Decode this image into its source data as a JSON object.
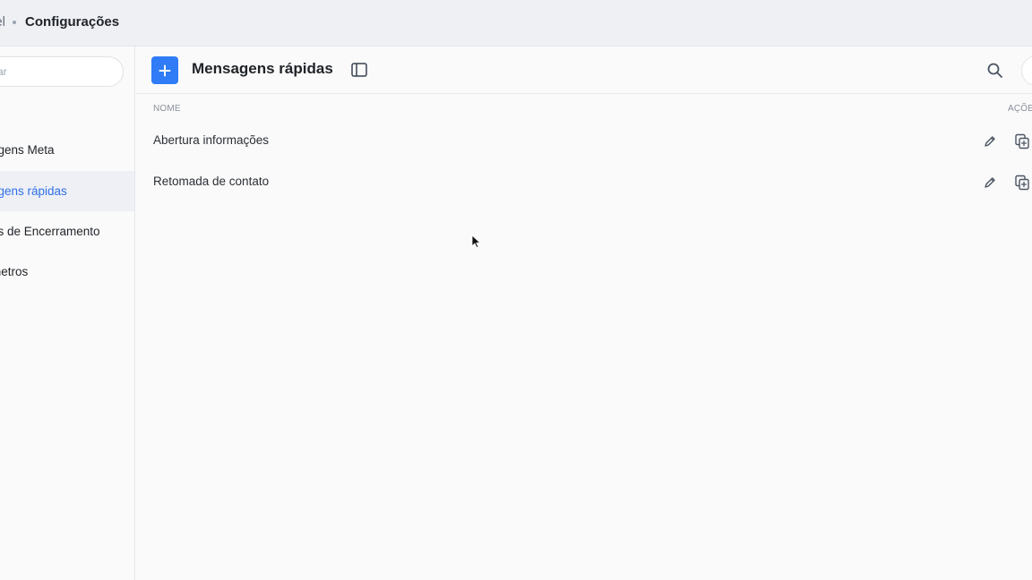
{
  "breadcrumb": {
    "parent": "nel",
    "current": "Configurações"
  },
  "sidebar": {
    "search_placeholder": "ar",
    "items": [
      {
        "label": "agens Meta",
        "active": false
      },
      {
        "label": "agens rápidas",
        "active": true
      },
      {
        "label": "os de Encerramento",
        "active": false
      },
      {
        "label": "metros",
        "active": false
      }
    ]
  },
  "header": {
    "title": "Mensagens rápidas",
    "add_icon": "plus-icon",
    "toggle_icon": "sidebar-panel-icon",
    "search_icon": "search-icon"
  },
  "table": {
    "columns": {
      "name": "NOME",
      "actions": "AÇÕE"
    },
    "rows": [
      {
        "name": "Abertura informações"
      },
      {
        "name": "Retomada de contato"
      }
    ]
  },
  "colors": {
    "accent": "#2f7cf6",
    "active_text": "#2f6fe4",
    "active_bg": "#eef0f6"
  }
}
